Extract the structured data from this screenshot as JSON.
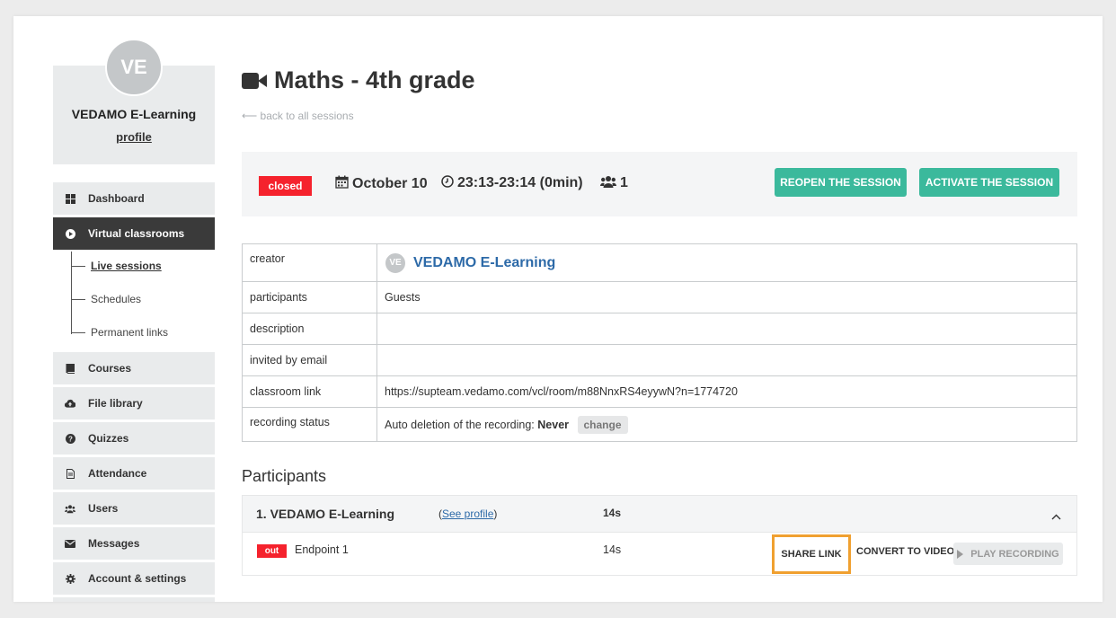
{
  "profile": {
    "initials": "VE",
    "name": "VEDAMO E-Learning",
    "link_label": "profile"
  },
  "sidebar": {
    "items": [
      {
        "label": "Dashboard",
        "icon": "dashboard-icon"
      },
      {
        "label": "Virtual classrooms",
        "icon": "play-circle-icon"
      },
      {
        "label": "Courses",
        "icon": "book-icon"
      },
      {
        "label": "File library",
        "icon": "cloud-upload-icon"
      },
      {
        "label": "Quizzes",
        "icon": "question-circle-icon"
      },
      {
        "label": "Attendance",
        "icon": "document-icon"
      },
      {
        "label": "Users",
        "icon": "users-icon"
      },
      {
        "label": "Messages",
        "icon": "envelope-icon"
      },
      {
        "label": "Account & settings",
        "icon": "gear-icon"
      }
    ],
    "subitems": [
      {
        "label": "Live sessions"
      },
      {
        "label": "Schedules"
      },
      {
        "label": "Permanent links"
      }
    ]
  },
  "page": {
    "title": "Maths - 4th grade",
    "back_label": "⟵ back to all sessions"
  },
  "session": {
    "status": "closed",
    "date": "October 10",
    "time": "23:13-23:14 (0min)",
    "participants_count": "1",
    "reopen_label": "REOPEN THE SESSION",
    "activate_label": "ACTIVATE THE SESSION"
  },
  "info": {
    "creator_label": "creator",
    "creator_initials": "VE",
    "creator_name": "VEDAMO E-Learning",
    "participants_label": "participants",
    "participants_value": "Guests",
    "description_label": "description",
    "description_value": "",
    "invited_label": "invited by email",
    "invited_value": "",
    "classroom_label": "classroom link",
    "classroom_value": "https://supteam.vedamo.com/vcl/room/m88NnxRS4eyywN?n=1774720",
    "recording_label": "recording status",
    "recording_prefix": "Auto deletion of the recording:",
    "recording_value": "Never",
    "change_label": "change"
  },
  "participants_section": {
    "title": "Participants",
    "entries": [
      {
        "name": "1. VEDAMO E-Learning",
        "see_profile": "See profile",
        "duration": "14s",
        "endpoints": [
          {
            "status": "out",
            "name": "Endpoint 1",
            "duration": "14s",
            "share_label": "SHARE LINK",
            "convert_label": "CONVERT TO VIDEO",
            "play_label": "PLAY RECORDING"
          }
        ]
      }
    ]
  },
  "colors": {
    "accent_green": "#3bb99c",
    "status_red": "#f5222d",
    "link_blue": "#2d6aa8",
    "highlight_orange": "#f0a030",
    "active_nav": "#3a3a3a"
  }
}
